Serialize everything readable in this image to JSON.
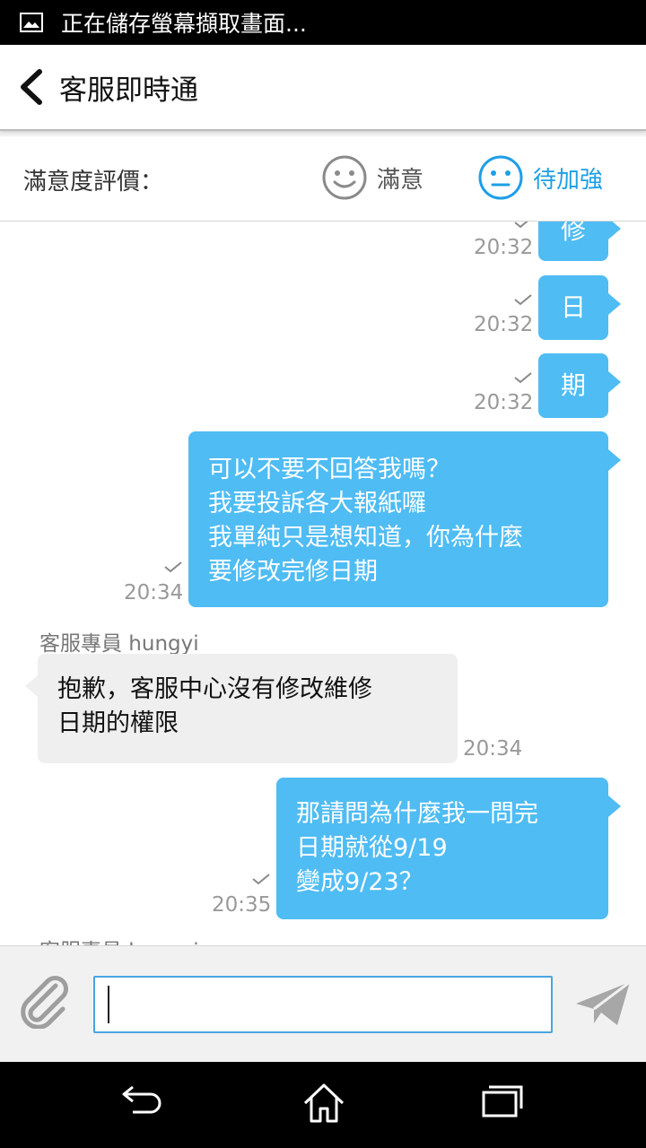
{
  "status_bar": {
    "text": "正在儲存螢幕擷取畫面..."
  },
  "header": {
    "title": "客服即時通"
  },
  "rating": {
    "label": "滿意度評價：",
    "satisfied": "滿意",
    "improve": "待加強"
  },
  "messages": {
    "m1": {
      "text": "修",
      "time": "20:32"
    },
    "m2": {
      "text": "日",
      "time": "20:32"
    },
    "m3": {
      "text": "期",
      "time": "20:32"
    },
    "m4": {
      "lines": [
        "可以不要不回答我嗎？",
        "我要投訴各大報紙囉",
        "我單純只是想知道，你為什麼",
        "要修改完修日期"
      ],
      "time": "20:34"
    },
    "m5": {
      "sender": "客服專員 hungyi",
      "lines": [
        "抱歉，客服中心沒有修改維修",
        "日期的權限"
      ],
      "time": "20:34"
    },
    "m6": {
      "lines": [
        "那請問為什麼我一問完",
        "日期就從9/19",
        "變成9/23？"
      ],
      "time": "20:35"
    },
    "m7": {
      "sender": "客服專員 hungyi"
    }
  },
  "input": {
    "value": ""
  },
  "colors": {
    "accent": "#4fbcf4",
    "incoming": "#efefef",
    "improve": "#1e9fe6"
  },
  "icons": [
    "image-icon",
    "back-arrow-icon",
    "smile-face-icon",
    "neutral-face-icon",
    "check-icon",
    "paperclip-icon",
    "send-icon",
    "nav-back-icon",
    "nav-home-icon",
    "nav-recents-icon"
  ]
}
